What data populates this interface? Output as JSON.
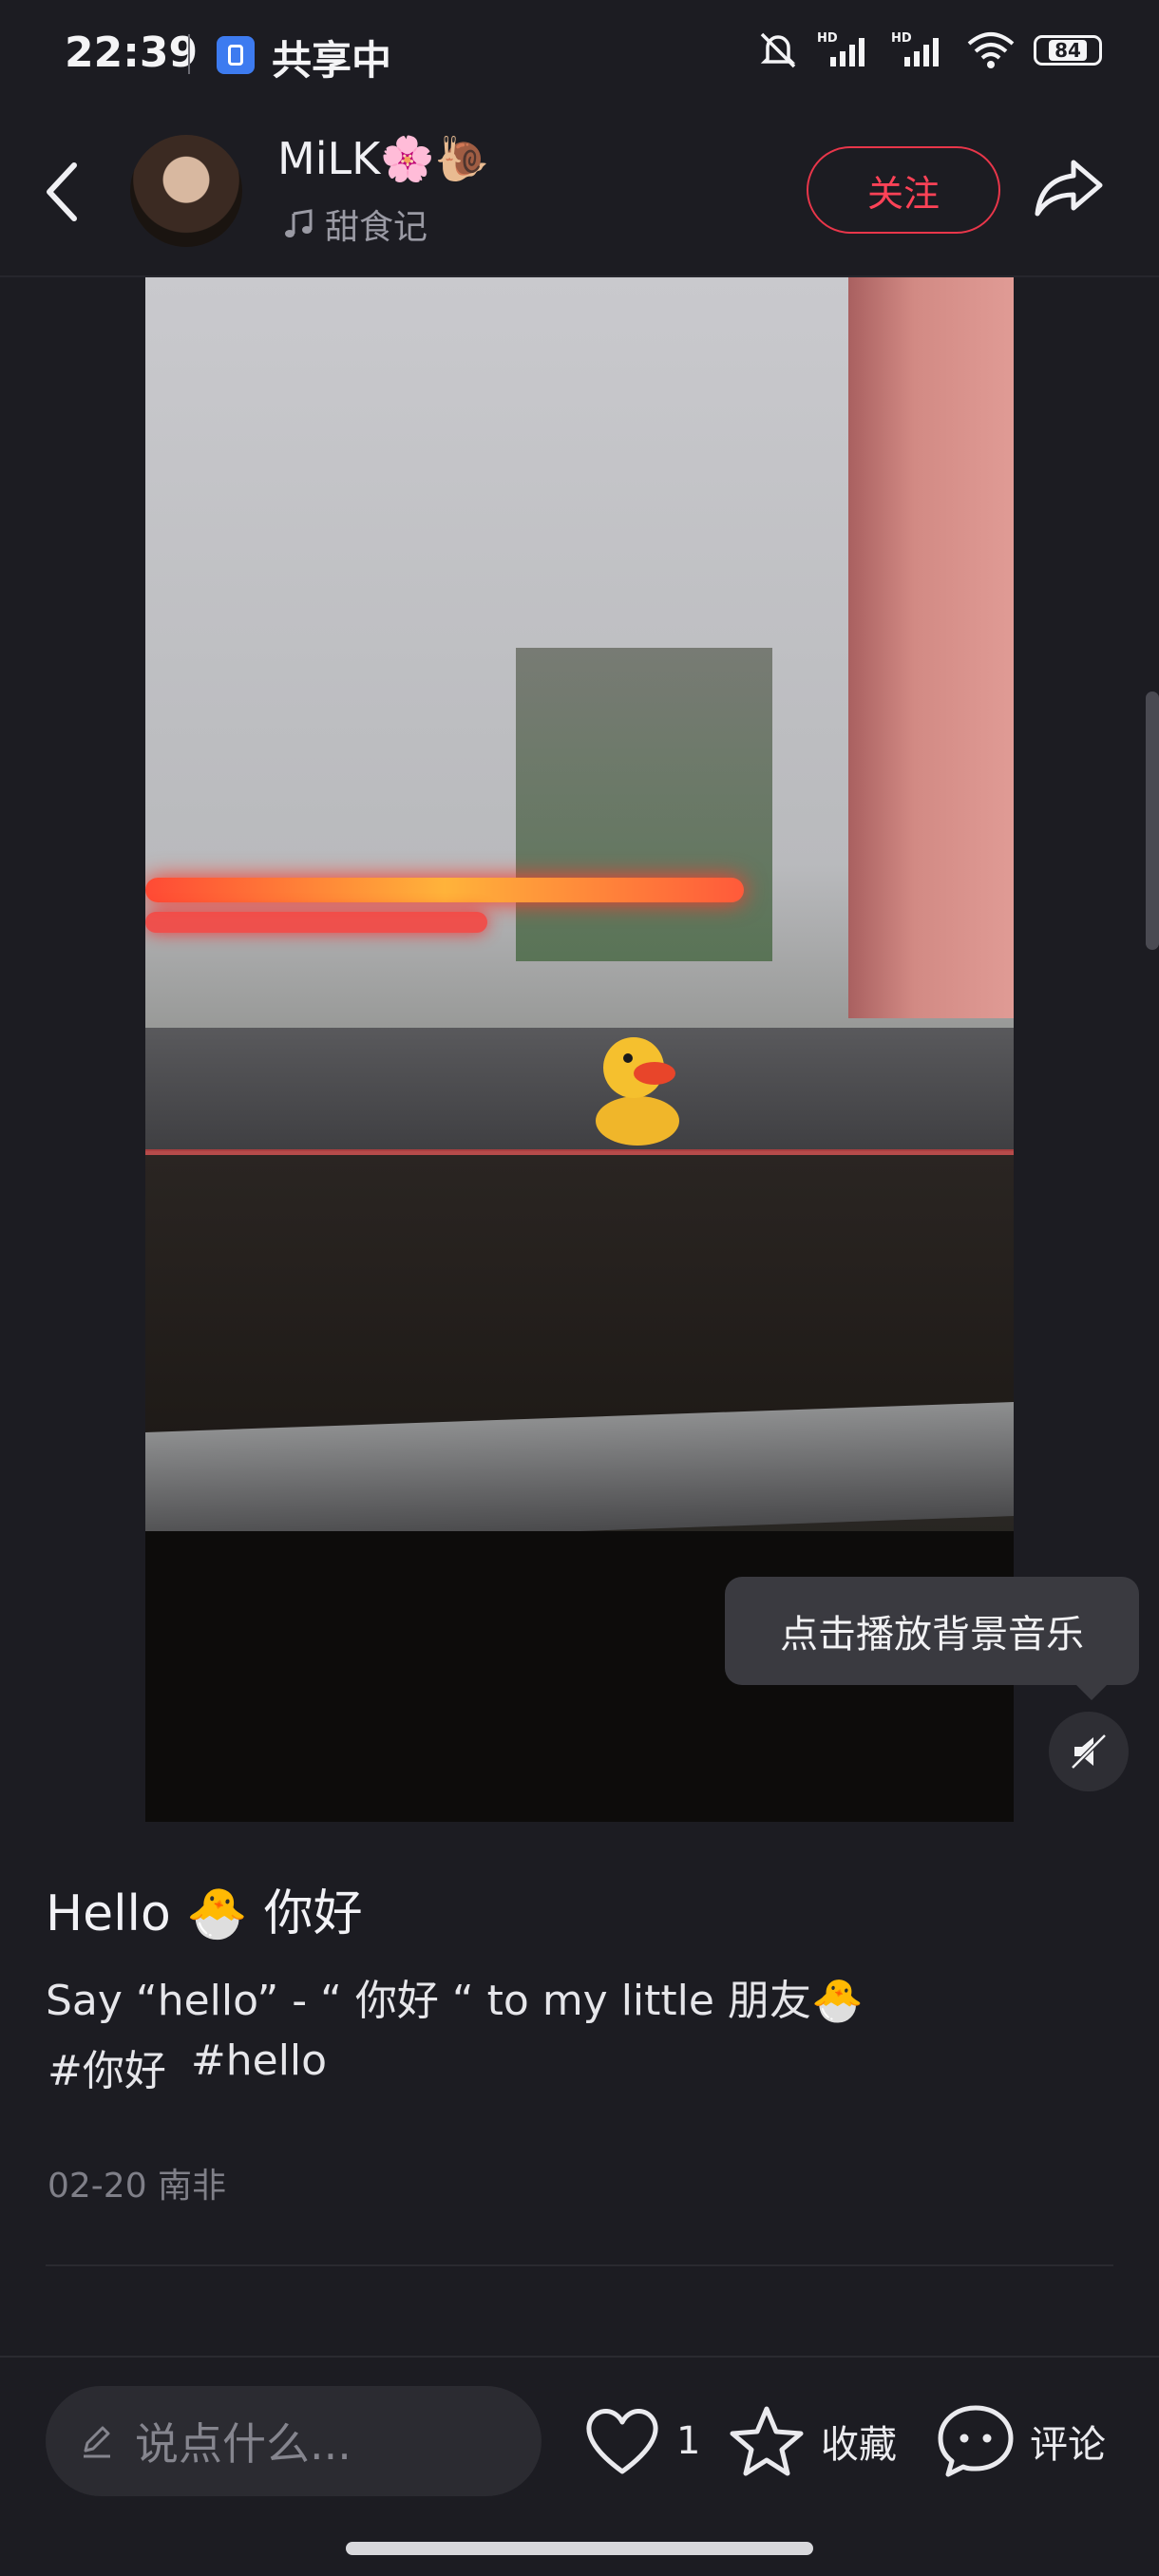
{
  "status_bar": {
    "time": "22:39",
    "sharing_label": "共享中",
    "battery": "84"
  },
  "header": {
    "username": "MiLK🌸🐌",
    "music_title": "甜食记",
    "follow_label": "关注"
  },
  "media": {
    "tooltip": "点击播放背景音乐"
  },
  "post": {
    "title": "Hello 🐣 你好",
    "body": "Say “hello” - “ 你好 “ to my little 朋友🐣",
    "tags": [
      "#你好",
      "#hello"
    ],
    "meta": "02-20 南非"
  },
  "bottom_bar": {
    "comment_placeholder": "说点什么...",
    "like_count": "1",
    "favorite_label": "收藏",
    "comment_label": "评论"
  },
  "colors": {
    "accent": "#ff4257",
    "background": "#1c1c22"
  }
}
